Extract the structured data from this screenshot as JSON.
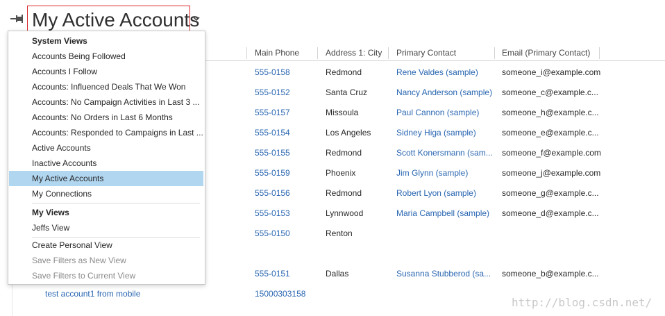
{
  "view_title": "My Active Accounts",
  "columns": [
    "Main Phone",
    "Address 1: City",
    "Primary Contact",
    "Email (Primary Contact)"
  ],
  "rows": [
    {
      "phone": "555-0158",
      "city": "Redmond",
      "contact": "Rene Valdes (sample)",
      "email": "someone_i@example.com"
    },
    {
      "phone": "555-0152",
      "city": "Santa Cruz",
      "contact": "Nancy Anderson (sample)",
      "email": "someone_c@example.c..."
    },
    {
      "phone": "555-0157",
      "city": "Missoula",
      "contact": "Paul Cannon (sample)",
      "email": "someone_h@example.c..."
    },
    {
      "phone": "555-0154",
      "city": "Los Angeles",
      "contact": "Sidney Higa (sample)",
      "email": "someone_e@example.c..."
    },
    {
      "phone": "555-0155",
      "city": "Redmond",
      "contact": "Scott Konersmann (sam...",
      "email": "someone_f@example.com"
    },
    {
      "phone": "555-0159",
      "city": "Phoenix",
      "contact": "Jim Glynn (sample)",
      "email": "someone_j@example.com"
    },
    {
      "phone": "555-0156",
      "city": "Redmond",
      "contact": "Robert Lyon (sample)",
      "email": "someone_g@example.c..."
    },
    {
      "phone": "555-0153",
      "city": "Lynnwood",
      "contact": "Maria Campbell (sample)",
      "email": "someone_d@example.c..."
    },
    {
      "phone": "555-0150",
      "city": "Renton",
      "contact": "",
      "email": ""
    },
    {
      "phone": "555-0151",
      "city": "Dallas",
      "contact": "Susanna Stubberod (sa...",
      "email": "someone_b@example.c..."
    },
    {
      "name": "test account1 from mobile",
      "phone": "15000303158",
      "city": "",
      "contact": "",
      "email": ""
    }
  ],
  "dropdown": {
    "system_views_heading": "System Views",
    "system_views": [
      "Accounts Being Followed",
      "Accounts I Follow",
      "Accounts: Influenced Deals That We Won",
      "Accounts: No Campaign Activities in Last 3 ...",
      "Accounts: No Orders in Last 6 Months",
      "Accounts: Responded to Campaigns in Last ...",
      "Active Accounts",
      "Inactive Accounts",
      "My Active Accounts",
      "My Connections"
    ],
    "my_views_heading": "My Views",
    "my_views": [
      "Jeffs View"
    ],
    "actions": [
      "Create Personal View",
      "Save Filters as New View",
      "Save Filters to Current View"
    ]
  },
  "watermark": "http://blog.csdn.net/",
  "colors": {
    "link": "#2966b1",
    "selected": "#b1d6f0",
    "highlight_border": "#d9262b"
  }
}
